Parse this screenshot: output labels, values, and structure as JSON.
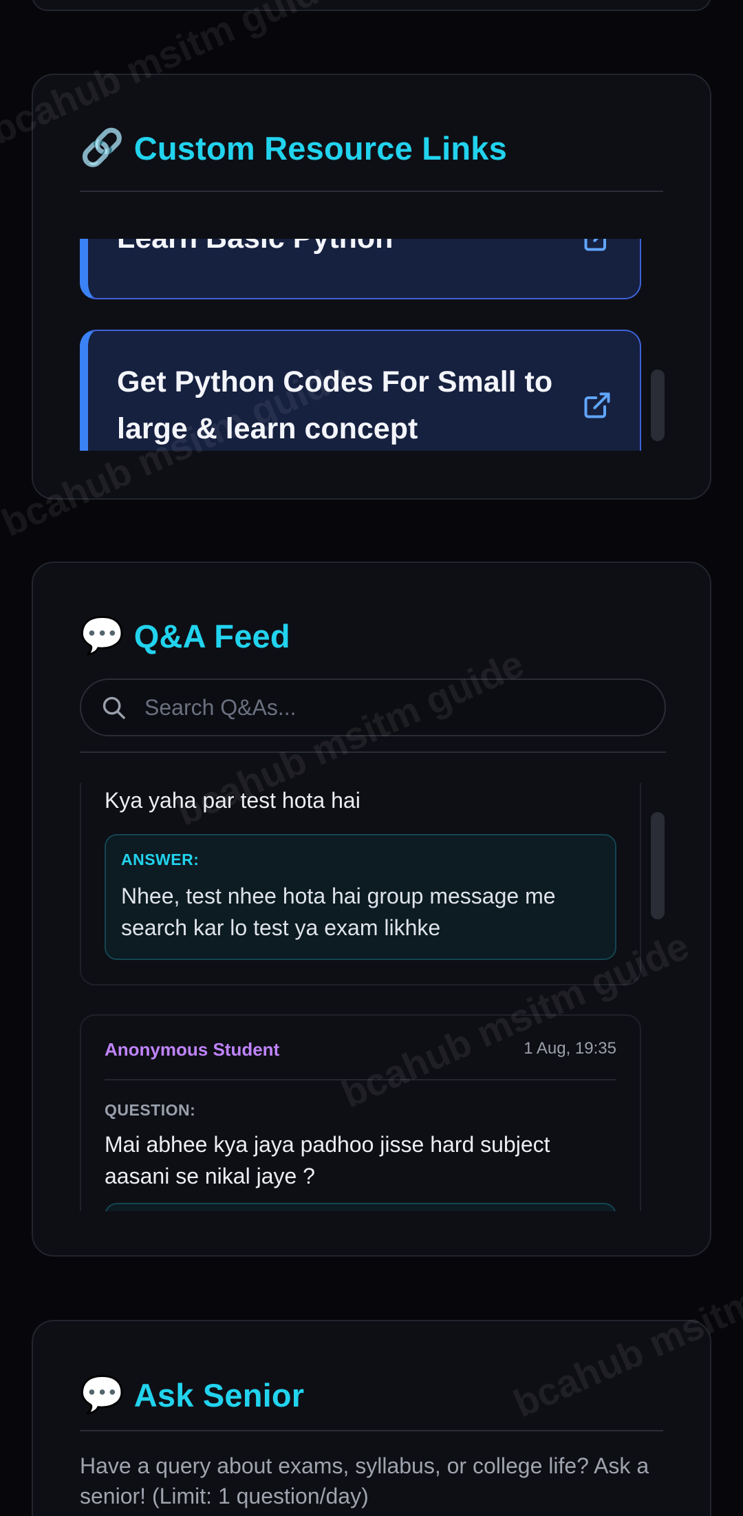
{
  "links_card": {
    "emoji": "🔗",
    "title": "Custom Resource Links",
    "items": [
      {
        "label": "Learn Basic Python"
      },
      {
        "label": "Get Python Codes For Small to large & learn concept"
      }
    ]
  },
  "qa_card": {
    "emoji": "💬",
    "title": "Q&A Feed",
    "search_placeholder": "Search Q&As...",
    "items": [
      {
        "question": "Kya yaha par test hota hai",
        "answer_label": "ANSWER:",
        "answer": "Nhee, test nhee hota hai group message me search kar lo test ya exam likhke"
      },
      {
        "author": "Anonymous Student",
        "timestamp": "1 Aug, 19:35",
        "question_label": "QUESTION:",
        "question": "Mai abhee kya jaya padhoo jisse hard subject aasani se nikal jaye ?"
      }
    ]
  },
  "ask_card": {
    "emoji": "💬",
    "title": "Ask Senior",
    "description": "Have a query about exams, syllabus, or college life? Ask a senior! (Limit: 1 question/day)"
  },
  "watermark": "bcahub msitm guide",
  "colors": {
    "accent": "#22d3ee",
    "author": "#c084fc",
    "link_border": "#3b82f6",
    "background": "#07070b"
  }
}
